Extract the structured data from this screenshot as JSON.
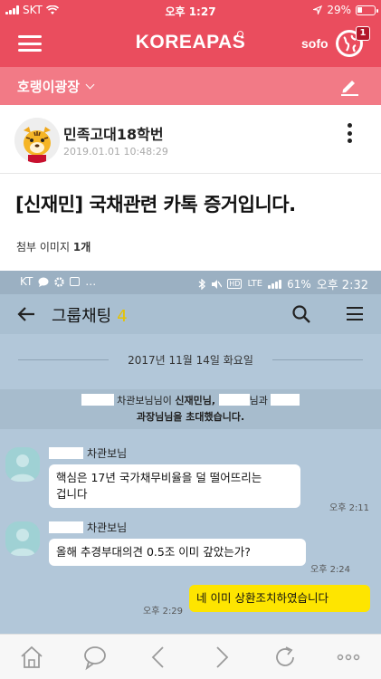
{
  "status_bar": {
    "carrier": "SKT",
    "time": "오후 1:27",
    "battery": "29%"
  },
  "header": {
    "brand": "KOREAPAS",
    "sofo": "sofo",
    "notification_count": "1"
  },
  "board": {
    "name": "호랭이광장"
  },
  "post": {
    "author": "민족고대18학번",
    "date": "2019.01.01 10:48:29",
    "title": "[신재민] 국채관련 카톡 증거입니다.",
    "attach_label": "첨부 이미지",
    "attach_count": "1개"
  },
  "screenshot": {
    "status": {
      "carrier": "KT",
      "network": "LTE",
      "battery": "61%",
      "time": "오후 2:32"
    },
    "chat_title": "그룹채팅",
    "member_count": "4",
    "date_divider": "2017년 11월 14일 화요일",
    "system_message": {
      "part1": "차관보님님이",
      "part2": "신재민님,",
      "part3": "님과",
      "part4": "과장님님을 초대했습니다."
    },
    "messages": [
      {
        "sender": "차관보님",
        "lines": [
          "핵심은 17년 국가채무비율을 덜 떨어뜨리는",
          "겁니다"
        ],
        "time": "오후 2:11"
      },
      {
        "sender": "차관보님",
        "lines": [
          "올해 추경부대의견 0.5조 이미 갚았는가?"
        ],
        "time": "오후 2:24"
      },
      {
        "lines": [
          "네 이미 상환조치하였습니다"
        ],
        "time": "오후 2:29",
        "mine": true
      }
    ]
  },
  "colors": {
    "brand_red": "#ea4d5e",
    "sub_pink": "#f27a86",
    "kakao_bg": "#b2c7d9",
    "kakao_yellow": "#fee500"
  }
}
